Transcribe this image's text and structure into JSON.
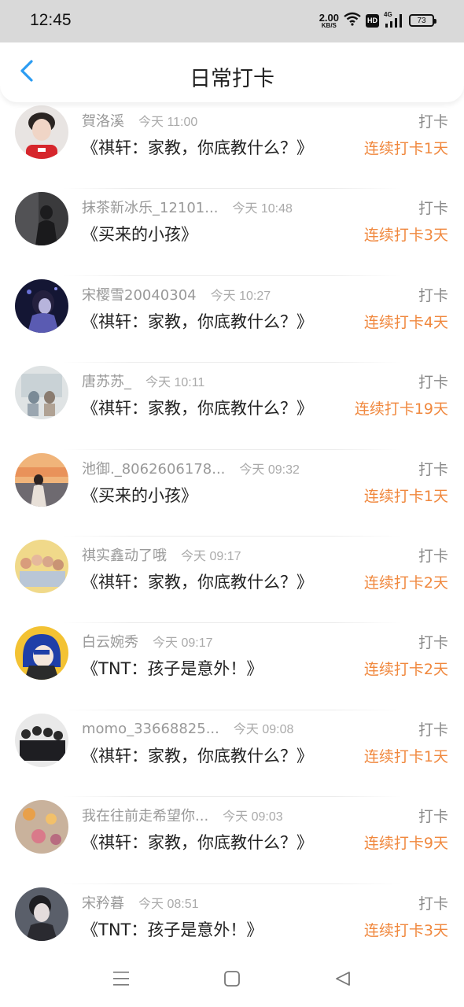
{
  "status_bar": {
    "time": "12:45",
    "speed_value": "2.00",
    "speed_unit": "KB/S",
    "hd_label": "HD",
    "network": "4G",
    "battery": "73",
    "icons": [
      "wifi-icon",
      "hd-icon",
      "signal-icon",
      "battery-icon"
    ]
  },
  "header": {
    "title": "日常打卡",
    "back_icon": "chevron-left-icon",
    "accent_color": "#2b9cf2"
  },
  "checkins": [
    {
      "name": "賀洛溪",
      "time": "今天 11:00",
      "book": "《祺轩：家教，你底教什么？》",
      "tag": "打卡",
      "streak": "连续打卡1天"
    },
    {
      "name": "抹茶新冰乐_12101...",
      "time": "今天 10:48",
      "book": "《买来的小孩》",
      "tag": "打卡",
      "streak": "连续打卡3天"
    },
    {
      "name": "宋樱雪20040304",
      "time": "今天 10:27",
      "book": "《祺轩：家教，你底教什么？》",
      "tag": "打卡",
      "streak": "连续打卡4天"
    },
    {
      "name": "唐苏苏_",
      "time": "今天 10:11",
      "book": "《祺轩：家教，你底教什么？》",
      "tag": "打卡",
      "streak": "连续打卡19天"
    },
    {
      "name": "池御._8062606178...",
      "time": "今天 09:32",
      "book": "《买来的小孩》",
      "tag": "打卡",
      "streak": "连续打卡1天"
    },
    {
      "name": "祺实鑫动了哦",
      "time": "今天 09:17",
      "book": "《祺轩：家教，你底教什么？》",
      "tag": "打卡",
      "streak": "连续打卡2天"
    },
    {
      "name": "白云婉秀",
      "time": "今天 09:17",
      "book": "《TNT：孩子是意外！》",
      "tag": "打卡",
      "streak": "连续打卡2天"
    },
    {
      "name": "momo_33668825...",
      "time": "今天 09:08",
      "book": "《祺轩：家教，你底教什么？》",
      "tag": "打卡",
      "streak": "连续打卡1天"
    },
    {
      "name": "我在往前走希望你...",
      "time": "今天 09:03",
      "book": "《祺轩：家教，你底教什么？》",
      "tag": "打卡",
      "streak": "连续打卡9天"
    },
    {
      "name": "宋矜暮",
      "time": "今天 08:51",
      "book": "《TNT：孩子是意外！》",
      "tag": "打卡",
      "streak": "连续打卡3天"
    }
  ],
  "colors": {
    "streak": "#f0883e",
    "tag": "#888888",
    "meta": "#999999",
    "status_bar_bg": "#d9d9d9"
  },
  "nav_bar": {
    "icons": [
      "menu-icon",
      "home-icon",
      "back-triangle-icon"
    ]
  }
}
